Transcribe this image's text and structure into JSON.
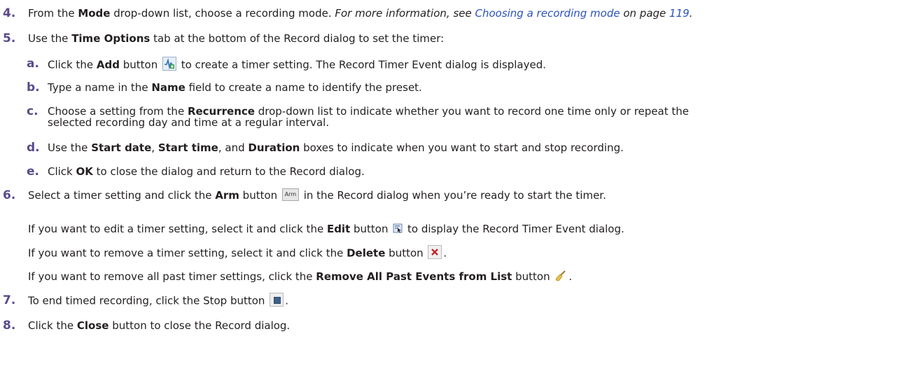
{
  "steps": {
    "s4": {
      "num": "4.",
      "t1": "From the ",
      "b1": "Mode",
      "t2": " drop-down list, choose a recording mode. ",
      "i1": "For more information, see ",
      "link1": "Choosing a recording mode",
      "i2": " on page ",
      "link2": "119",
      "i3": "."
    },
    "s5": {
      "num": "5.",
      "t1": "Use the ",
      "b1": "Time Options",
      "t2": " tab at the bottom of the Record dialog to set the timer:",
      "a": {
        "num": "a.",
        "t1": "Click the ",
        "b1": "Add",
        "t2": " button ",
        "t3": " to create a timer setting. The Record Timer Event dialog is displayed."
      },
      "b": {
        "num": "b.",
        "t1": "Type a name in the ",
        "b1": "Name",
        "t2": " field to create a name to identify the preset."
      },
      "c": {
        "num": "c.",
        "t1": "Choose a setting from the ",
        "b1": "Recurrence",
        "t2": " drop-down list to indicate whether you want to record one time only or repeat the",
        "t3": "selected recording day and time at a regular interval."
      },
      "d": {
        "num": "d.",
        "t1": "Use the ",
        "b1": "Start date",
        "t2": ", ",
        "b2": "Start time",
        "t3": ", and ",
        "b3": "Duration",
        "t4": " boxes to indicate when you want to start and stop recording."
      },
      "e": {
        "num": "e.",
        "t1": "Click ",
        "b1": "OK",
        "t2": " to close the dialog and return to the Record dialog."
      }
    },
    "s6": {
      "num": "6.",
      "t1": "Select a timer setting and click the ",
      "b1": "Arm",
      "t2": " button ",
      "arm_icon": "Arm",
      "t3": " in the Record dialog when you’re ready to start the timer.",
      "p1": {
        "t1": "If you want to edit a timer setting, select it and click the ",
        "b1": "Edit",
        "t2": " button ",
        "t3": " to display the Record Timer Event dialog."
      },
      "p2": {
        "t1": "If you want to remove a timer setting, select it and click the ",
        "b1": "Delete",
        "t2": " button ",
        "t3": "."
      },
      "p3": {
        "t1": "If you want to remove all past timer settings, click the ",
        "b1": "Remove All Past Events from List",
        "t2": " button ",
        "t3": "."
      }
    },
    "s7": {
      "num": "7.",
      "t1": "To end timed recording, click the Stop button ",
      "t2": "."
    },
    "s8": {
      "num": "8.",
      "t1": "Click the ",
      "b1": "Close",
      "t2": " button to close the Record dialog."
    }
  },
  "icons": {
    "add": "add-timer-icon",
    "arm": "arm-icon",
    "edit": "edit-icon",
    "delete": "delete-icon",
    "broom": "remove-past-events-icon",
    "stop": "stop-icon"
  },
  "colors": {
    "step_number": "#5a4a8c",
    "link": "#2a52be",
    "delete_x": "#c0282d"
  }
}
